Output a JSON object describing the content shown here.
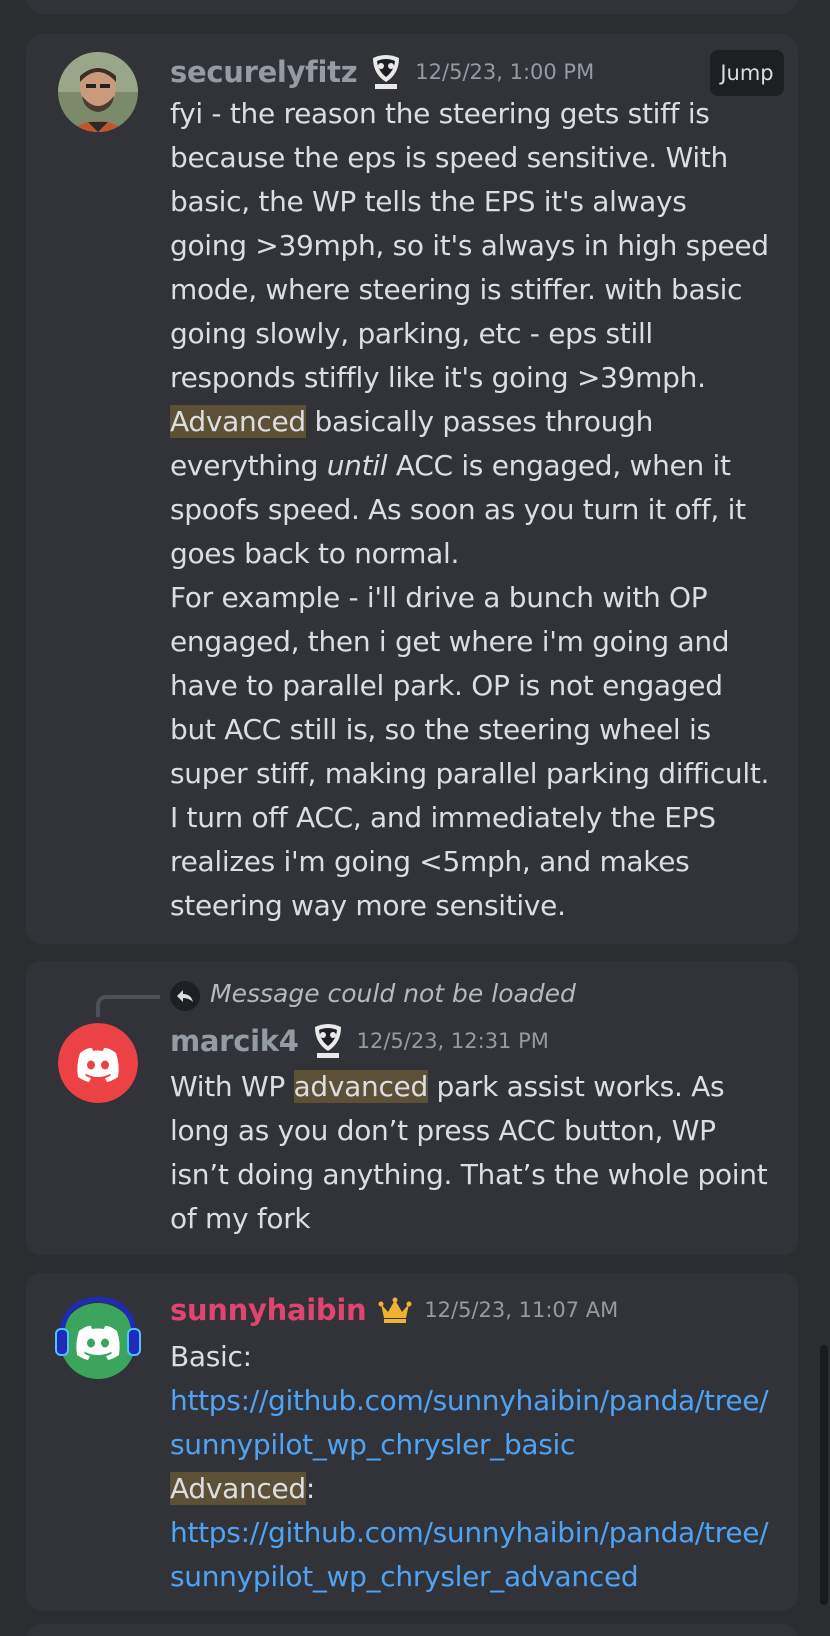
{
  "messages": [
    {
      "username": "securelyfitz",
      "timestamp": "12/5/23, 1:00 PM",
      "jump_label": "Jump",
      "role_icon": "ram-logo-icon",
      "paragraphs": {
        "p1": "fyi - the reason the steering gets stiff is because the eps is speed sensitive. With basic, the WP tells the EPS it's always going >39mph, so it's always in high speed mode, where steering is stiffer. with basic going slowly, parking, etc - eps still responds stiffly like it's going >39mph.",
        "hl1": "Advanced",
        "p2a": " basically passes through everything ",
        "em1": "until",
        "p2b": " ACC is engaged, when it spoofs speed. As soon as you turn it off, it goes back to normal.",
        "p3": "For example - i'll drive a bunch with OP engaged, then i get where i'm going and have to parallel park. OP is not engaged but ACC still is, so the steering wheel is super stiff, making parallel parking difficult. I turn off ACC, and immediately the EPS realizes i'm going <5mph, and makes steering way more sensitive."
      }
    },
    {
      "reply_text": "Message could not be loaded",
      "username": "marcik4",
      "timestamp": "12/5/23, 12:31 PM",
      "role_icon": "ram-logo-icon",
      "paragraphs": {
        "p1a": "With WP ",
        "hl1": "advanced",
        "p1b": " park assist works. As long as you don’t press ACC button, WP isn’t doing anything. That’s the whole point of my fork"
      }
    },
    {
      "username": "sunnyhaibin",
      "timestamp": "12/5/23, 11:07 AM",
      "role_icon": "crown-icon",
      "paragraphs": {
        "p1": "Basic:",
        "link1": "https://github.com/sunnyhaibin/panda/tree/sunnypilot_wp_chrysler_basic",
        "hl1": "Advanced",
        "p2": ":",
        "link2": "https://github.com/sunnyhaibin/panda/tree/sunnypilot_wp_chrysler_advanced"
      }
    }
  ],
  "colors": {
    "background": "#2b2d31",
    "card": "#313338",
    "highlight": "#5c5036",
    "link": "#4fa3f5",
    "owner_name": "#e0456f",
    "discord_red": "#ed4245",
    "discord_green": "#3ba55d"
  }
}
